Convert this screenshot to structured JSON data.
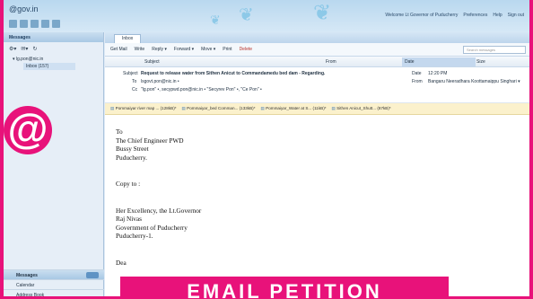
{
  "brand": "@gov.in",
  "top_links": [
    "Welcome Lt Governor of Puducherry",
    "Preferences",
    "Help",
    "Sign out"
  ],
  "sidebar": {
    "header": "Messages",
    "account": "lg.pon@nic.in",
    "inbox": "Inbox (157)",
    "bottom": [
      {
        "label": "Messages",
        "active": true
      },
      {
        "label": "Calendar",
        "active": false
      },
      {
        "label": "Address Book",
        "active": false
      }
    ]
  },
  "tab_label": "Inbox",
  "toolbar": {
    "get_mail": "Get Mail",
    "write": "Write",
    "reply": "Reply ▾",
    "forward": "Forward ▾",
    "move": "Move ▾",
    "print": "Print",
    "delete": "Delete",
    "search_placeholder": "Search messages"
  },
  "columns": {
    "subject": "Subject",
    "from": "From",
    "date": "Date",
    "size": "Size"
  },
  "header": {
    "subject_label": "Subject",
    "subject": "Request to release water from Sithen Anicut to Commandamedu bed dam - Regarding.",
    "to_label": "To",
    "to": "lsgovt.pon@nic.in •",
    "cc_label": "Cc",
    "cc": "\"lg.pon\" •, secypwd.pon@nic.in • \"Secyrev Pon\" •, \"Ce Pon\" •",
    "date_label": "Date",
    "date": "12:20 PM",
    "from_label": "From",
    "from": "Bangaru Neeradhara Koottamaippu Singhari ▾"
  },
  "attachments": [
    "Pommaiyar river map ... (128kB)*",
    "Pommaiyar_bed Comman... (133kB)*",
    "Pommaiyar_Water at S... (11kB)*",
    "Sithen Anicut_Shutt... (87kB)*"
  ],
  "body": {
    "to_line": "To",
    "addr1": "The Chief Engineer PWD",
    "addr2": "Bussy Street",
    "addr3": "Puducherry.",
    "copy_to": "Copy to :",
    "cc1": "Her Excellency, the Lt.Governor",
    "cc2": "Raj Nivas",
    "cc3": "Government of Puducherry",
    "cc4": "Puducherry-1.",
    "footer_start": "Dea"
  },
  "at_symbol": "@",
  "banner": "EMAIL PETITION",
  "colors": {
    "accent": "#e8127a",
    "chrome": "#dfeaf6"
  }
}
